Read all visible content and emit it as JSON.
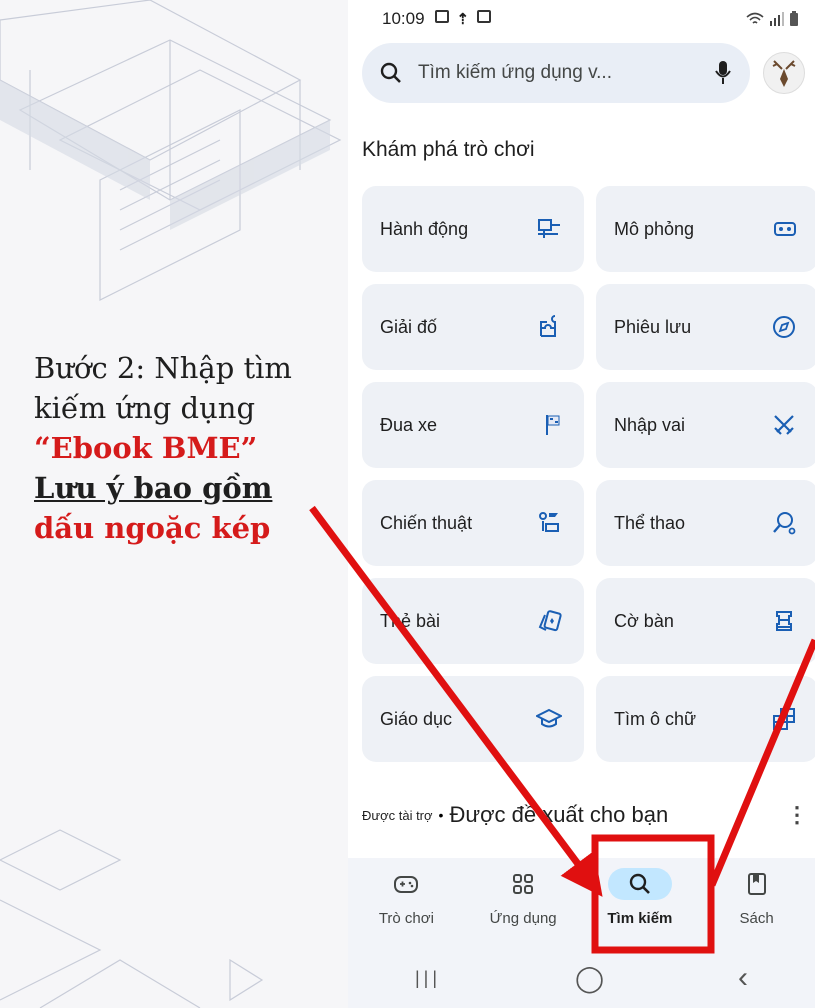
{
  "instruction": {
    "part1": "Bước 2: Nhập tìm kiếm ứng dụng ",
    "highlight": "“Ebook BME”",
    "note_underline": "Lưu ý bao gồm",
    "note_red": "dấu ngoặc kép"
  },
  "status_bar": {
    "time": "10:09"
  },
  "search": {
    "placeholder": "Tìm kiếm ứng dụng v...",
    "icon": "search-icon",
    "mic_icon": "mic-icon"
  },
  "section_title": "Khám phá trò chơi",
  "categories": [
    {
      "label": "Hành động",
      "icon": "action-icon"
    },
    {
      "label": "Mô phỏng",
      "icon": "vr-icon"
    },
    {
      "label": "Giải đố",
      "icon": "puzzle-icon"
    },
    {
      "label": "Phiêu lưu",
      "icon": "compass-icon"
    },
    {
      "label": "Đua xe",
      "icon": "flag-icon"
    },
    {
      "label": "Nhập vai",
      "icon": "swords-icon"
    },
    {
      "label": "Chiến thuật",
      "icon": "strategy-icon"
    },
    {
      "label": "Thể thao",
      "icon": "sports-icon"
    },
    {
      "label": "Thẻ bài",
      "icon": "cards-icon"
    },
    {
      "label": "Cờ bàn",
      "icon": "chess-icon"
    },
    {
      "label": "Giáo dục",
      "icon": "graduation-cap-icon"
    },
    {
      "label": "Tìm ô chữ",
      "icon": "crossword-icon"
    }
  ],
  "sponsored": {
    "label": "Được tài trợ",
    "separator": "•",
    "title": "Được đề xuất cho bạn",
    "more": "⋮"
  },
  "bottom_nav": [
    {
      "label": "Trò chơi",
      "icon": "gamepad-icon",
      "active": false
    },
    {
      "label": "Ứng dụng",
      "icon": "apps-icon",
      "active": false
    },
    {
      "label": "Tìm kiếm",
      "icon": "search-icon",
      "active": true
    },
    {
      "label": "Sách",
      "icon": "book-icon",
      "active": false
    }
  ],
  "system_nav": {
    "recents": "|||",
    "home": "◯",
    "back": "‹"
  },
  "colors": {
    "highlight": "#d51b1b",
    "active_pill": "#c2e7ff",
    "card_bg": "#eef1f6",
    "search_bg": "#e9eef6"
  }
}
